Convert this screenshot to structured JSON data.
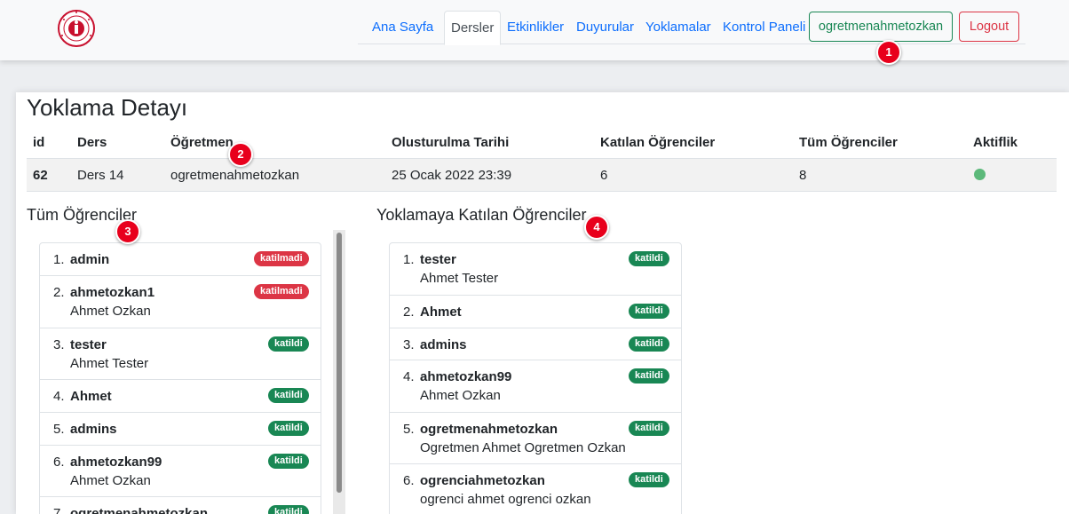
{
  "nav": {
    "items": [
      {
        "label": "Ana Sayfa"
      },
      {
        "label": "Dersler",
        "active": true
      },
      {
        "label": "Etkinlikler"
      },
      {
        "label": "Duyurular"
      },
      {
        "label": "Yoklamalar"
      },
      {
        "label": "Kontrol Paneli"
      }
    ],
    "user_button": "ogretmenahmetozkan",
    "logout_button": "Logout"
  },
  "markers": [
    "1",
    "2",
    "3",
    "4"
  ],
  "page": {
    "title": "Yoklama Detayı"
  },
  "table": {
    "headers": [
      "id",
      "Ders",
      "Öğretmen",
      "Olusturulma Tarihi",
      "Katılan Öğrenciler",
      "Tüm Öğrenciler",
      "Aktiflik"
    ],
    "row": {
      "id": "62",
      "ders": "Ders 14",
      "ogretmen": "ogretmenahmetozkan",
      "tarih": "25 Ocak 2022 23:39",
      "katilan": "6",
      "tum": "8",
      "aktif_color": "#5cb97a"
    }
  },
  "all_students": {
    "title": "Tüm Öğrenciler",
    "items": [
      {
        "num": "1.",
        "username": "admin",
        "fullname": "",
        "status": "katilmadi"
      },
      {
        "num": "2.",
        "username": "ahmetozkan1",
        "fullname": "Ahmet Ozkan",
        "status": "katilmadi"
      },
      {
        "num": "3.",
        "username": "tester",
        "fullname": "Ahmet Tester",
        "status": "katildi"
      },
      {
        "num": "4.",
        "username": "Ahmet",
        "fullname": "",
        "status": "katildi"
      },
      {
        "num": "5.",
        "username": "admins",
        "fullname": "",
        "status": "katildi"
      },
      {
        "num": "6.",
        "username": "ahmetozkan99",
        "fullname": "Ahmet Ozkan",
        "status": "katildi"
      },
      {
        "num": "7.",
        "username": "ogretmenahmetozkan",
        "fullname": "",
        "status": "katildi"
      }
    ]
  },
  "attended_students": {
    "title": "Yoklamaya Katılan Öğrenciler",
    "items": [
      {
        "num": "1.",
        "username": "tester",
        "fullname": "Ahmet Tester",
        "status": "katildi"
      },
      {
        "num": "2.",
        "username": "Ahmet",
        "fullname": "",
        "status": "katildi"
      },
      {
        "num": "3.",
        "username": "admins",
        "fullname": "",
        "status": "katildi"
      },
      {
        "num": "4.",
        "username": "ahmetozkan99",
        "fullname": "Ahmet Ozkan",
        "status": "katildi"
      },
      {
        "num": "5.",
        "username": "ogretmenahmetozkan",
        "fullname": "Ogretmen Ahmet Ogretmen Ozkan",
        "status": "katildi"
      },
      {
        "num": "6.",
        "username": "ogrenciahmetozkan",
        "fullname": "ogrenci ahmet ogrenci ozkan",
        "status": "katildi"
      }
    ]
  },
  "colors": {
    "katildi": "#198754",
    "katilmadi": "#dc3545",
    "link": "#0d6efd",
    "marker": "#e8001c"
  }
}
